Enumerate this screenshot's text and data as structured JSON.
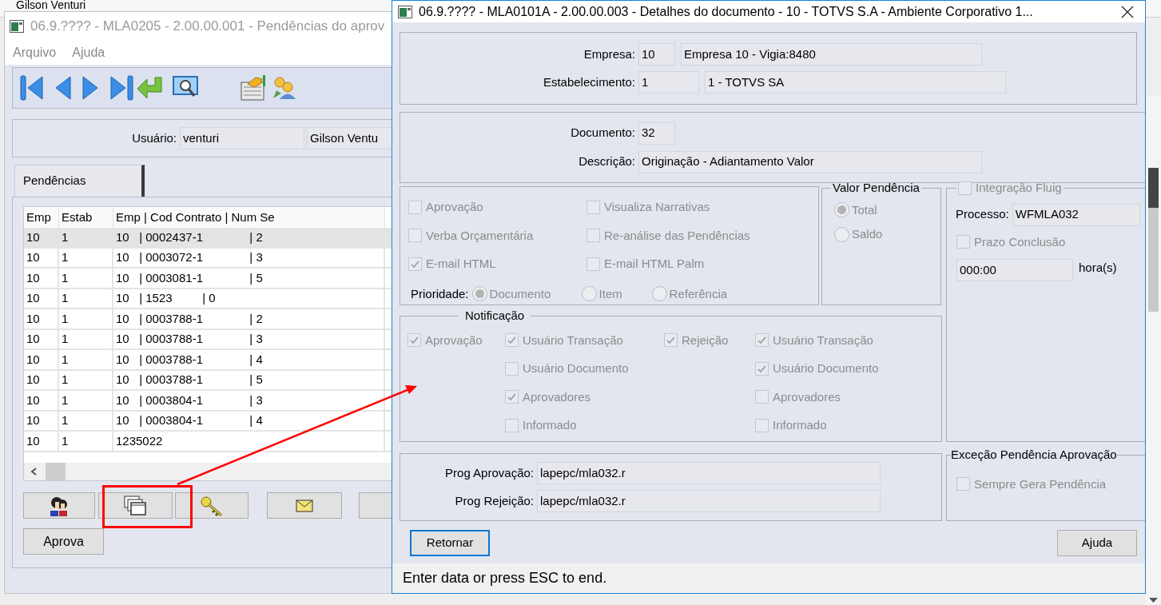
{
  "background_window": {
    "text": "Gilson Venturi"
  },
  "main_window": {
    "title": "06.9.???? - MLA0205 - 2.00.00.001 - Pendências do aprov",
    "menu": [
      "Arquivo",
      "Ajuda"
    ],
    "user": {
      "label": "Usuário:",
      "login": "venturi",
      "name": "Gilson Ventu"
    },
    "tabs": [
      {
        "label": "Pendências",
        "selected": true
      }
    ],
    "table": {
      "columns": [
        "Emp",
        "Estab",
        "Emp | Cod Contrato | Num Se"
      ],
      "rows": [
        {
          "cells": [
            "10",
            "1",
            "10   | 0002437-1              | 2"
          ],
          "selected": true
        },
        {
          "cells": [
            "10",
            "1",
            "10   | 0003072-1              | 3"
          ],
          "selected": false
        },
        {
          "cells": [
            "10",
            "1",
            "10   | 0003081-1              | 5"
          ],
          "selected": false
        },
        {
          "cells": [
            "10",
            "1",
            "10   | 1523         | 0"
          ],
          "selected": false
        },
        {
          "cells": [
            "10",
            "1",
            "10   | 0003788-1              | 2"
          ],
          "selected": false
        },
        {
          "cells": [
            "10",
            "1",
            "10   | 0003788-1              | 3"
          ],
          "selected": false
        },
        {
          "cells": [
            "10",
            "1",
            "10   | 0003788-1              | 4"
          ],
          "selected": false
        },
        {
          "cells": [
            "10",
            "1",
            "10   | 0003788-1              | 5"
          ],
          "selected": false
        },
        {
          "cells": [
            "10",
            "1",
            "10   | 0003804-1              | 3"
          ],
          "selected": false
        },
        {
          "cells": [
            "10",
            "1",
            "10   | 0003804-1              | 4"
          ],
          "selected": false
        },
        {
          "cells": [
            "10",
            "1",
            "1235022"
          ],
          "selected": false
        }
      ]
    },
    "approve_button": "Aprova"
  },
  "detail_window": {
    "title": "06.9.???? - MLA0101A - 2.00.00.003 - Detalhes do documento - 10 - TOTVS S.A - Ambiente Corporativo 1...",
    "company_fields": [
      {
        "label": "Empresa:",
        "code": "10",
        "name": "Empresa 10 - Vigia:8480"
      },
      {
        "label": "Estabelecimento:",
        "code": "1",
        "name": "1 - TOTVS SA"
      }
    ],
    "document_fields": [
      {
        "label": "Documento:",
        "value": "32"
      },
      {
        "label": "Descrição:",
        "value": "Originação - Adiantamento Valor"
      }
    ],
    "options": [
      {
        "label": "Aprovação",
        "checked": false,
        "disabled": true
      },
      {
        "label": "Visualiza Narrativas",
        "checked": false,
        "disabled": true
      },
      {
        "label": "Verba Orçamentária",
        "checked": false,
        "disabled": true
      },
      {
        "label": "Re-análise das Pendências",
        "checked": false,
        "disabled": true
      },
      {
        "label": "E-mail HTML",
        "checked": true,
        "disabled": true
      },
      {
        "label": "E-mail HTML Palm",
        "checked": false,
        "disabled": true
      }
    ],
    "priority": {
      "label": "Prioridade:",
      "options": [
        {
          "label": "Documento",
          "selected": true,
          "disabled": true
        },
        {
          "label": "Item",
          "selected": false,
          "disabled": true
        },
        {
          "label": "Referência",
          "selected": false,
          "disabled": true
        }
      ]
    },
    "valor_pendencia": {
      "title": "Valor Pendência",
      "options": [
        {
          "label": "Total",
          "selected": true,
          "disabled": true
        },
        {
          "label": "Saldo",
          "selected": false,
          "disabled": true
        }
      ]
    },
    "fluig": {
      "integration": {
        "label": "Integração Fluig",
        "checked": false,
        "disabled": true
      },
      "process_label": "Processo:",
      "process": "WFMLA032",
      "deadline": {
        "label": "Prazo Conclusão",
        "checked": false,
        "disabled": true
      },
      "time": "000:00",
      "unit": "hora(s)"
    },
    "notification": {
      "title": "Notificação",
      "groups": [
        {
          "label": "Aprovação",
          "checked": true,
          "disabled": true,
          "items": [
            {
              "label": "Usuário Transação",
              "checked": true,
              "disabled": true
            },
            {
              "label": "Usuário Documento",
              "checked": false,
              "disabled": true
            },
            {
              "label": "Aprovadores",
              "checked": true,
              "disabled": true
            },
            {
              "label": "Informado",
              "checked": false,
              "disabled": true
            }
          ]
        },
        {
          "label": "Rejeição",
          "checked": true,
          "disabled": true,
          "items": [
            {
              "label": "Usuário Transação",
              "checked": true,
              "disabled": true
            },
            {
              "label": "Usuário Documento",
              "checked": true,
              "disabled": true
            },
            {
              "label": "Aprovadores",
              "checked": false,
              "disabled": true
            },
            {
              "label": "Informado",
              "checked": false,
              "disabled": true
            }
          ]
        }
      ]
    },
    "programs": [
      {
        "label": "Prog Aprovação:",
        "value": "lapepc/mla032.r"
      },
      {
        "label": "Prog Rejeição:",
        "value": "lapepc/mla032.r"
      }
    ],
    "exception": {
      "title": "Exceção Pendência Aprovação",
      "option": {
        "label": "Sempre Gera Pendência",
        "checked": false,
        "disabled": true
      }
    },
    "buttons": [
      {
        "label": "Retornar",
        "focused": true
      },
      {
        "label": "Ajuda",
        "focused": false
      }
    ],
    "status": "Enter data or press ESC to end."
  }
}
